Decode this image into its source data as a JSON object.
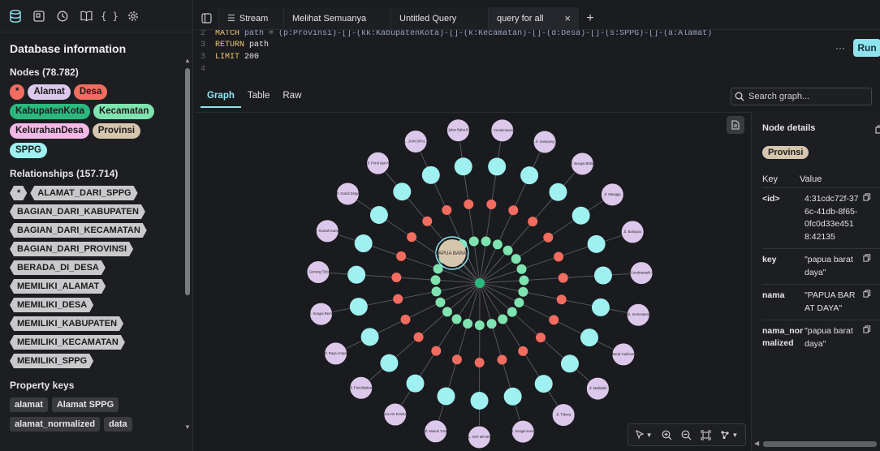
{
  "db": {
    "title": "Database information",
    "nodes_label": "Nodes (78.782)",
    "node_labels": [
      {
        "label": "*",
        "color": "#f26d5f"
      },
      {
        "label": "Alamat",
        "color": "#dcc8ea"
      },
      {
        "label": "Desa",
        "color": "#f26d5f"
      },
      {
        "label": "KabupatenKota",
        "color": "#2bb87f"
      },
      {
        "label": "Kecamatan",
        "color": "#7fe3b0"
      },
      {
        "label": "KelurahanDesa",
        "color": "#f3b8e6"
      },
      {
        "label": "Provinsi",
        "color": "#d7c6ae"
      },
      {
        "label": "SPPG",
        "color": "#9ff0f0"
      }
    ],
    "relationships_label": "Relationships (157.714)",
    "relationship_types": [
      "*",
      "ALAMAT_DARI_SPPG",
      "BAGIAN_DARI_KABUPATEN",
      "BAGIAN_DARI_KECAMATAN",
      "BAGIAN_DARI_PROVINSI",
      "BERADA_DI_DESA",
      "MEMILIKI_ALAMAT",
      "MEMILIKI_DESA",
      "MEMILIKI_KABUPATEN",
      "MEMILIKI_KECAMATAN",
      "MEMILIKI_SPPG"
    ],
    "property_keys_label": "Property keys",
    "property_keys": [
      "alamat",
      "Alamat SPPG",
      "alamat_normalized",
      "data"
    ]
  },
  "tabs": [
    {
      "label": "Stream"
    },
    {
      "label": "Melihat Semuanya"
    },
    {
      "label": "Untitled Query"
    },
    {
      "label": "query for all",
      "close": "×"
    }
  ],
  "tab_add": "+",
  "editor": {
    "lines": [
      {
        "num": "2",
        "keyword": "MATCH",
        "text": " path = (p:Provinsi)-[]-(kk:KabupatenKota)-[]-(k:Kecamatan)-[]-(d:Desa)-[]-(s:SPPG)-[]-(a:Alamat)"
      },
      {
        "num": "3",
        "keyword": "RETURN",
        "text": " path"
      },
      {
        "num": "3",
        "keyword": "LIMIT",
        "text": " 200"
      },
      {
        "num": "4",
        "keyword": "",
        "text": ""
      }
    ],
    "run_label": "Run",
    "more": "···"
  },
  "result_tabs": [
    "Graph",
    "Table",
    "Raw"
  ],
  "search": {
    "placeholder": "Search graph..."
  },
  "graph": {
    "center_label": "PAPUA BARAT",
    "alamat_labels": [
      "Jl. Cenderawasih",
      "Jl. Kampung",
      "Jl. Bungai Bebar",
      "Jl. Mangga",
      "Jl. Bahayau",
      "Jl. Cendrawasih Kel",
      "Jl. Sementara",
      "Jl. Banjir Kalimantan",
      "Jl. Malibakit",
      "Jl. Trikora",
      "Jl. Sungai Kamu",
      "JL. INTI MPURA",
      "Jl. Masuk Tutu",
      "JALAN RAWU",
      "Jl. Pondidiakan",
      "Jl. Raya Ampat",
      "Jl. Sungai Remu",
      "Jl. Gunung Tidore",
      "Jl. Rumah Kamm",
      "Jl. Gandi Dinge",
      "Jl. Pond dan N",
      "JL. JAIN DRAL S",
      "Jalan Baba B"
    ]
  },
  "details": {
    "title": "Node details",
    "chip": "Provinsi",
    "key_header": "Key",
    "value_header": "Value",
    "rows": [
      {
        "key": "<id>",
        "value": "4:31cdc72f-376c-41db-8f65-0fc0d33e4518:42135"
      },
      {
        "key": "key",
        "value": "\"papua barat daya\""
      },
      {
        "key": "nama",
        "value": "\"PAPUA BARAT DAYA\""
      },
      {
        "key": "nama_normalized",
        "value": "\"papua barat daya\""
      }
    ]
  }
}
